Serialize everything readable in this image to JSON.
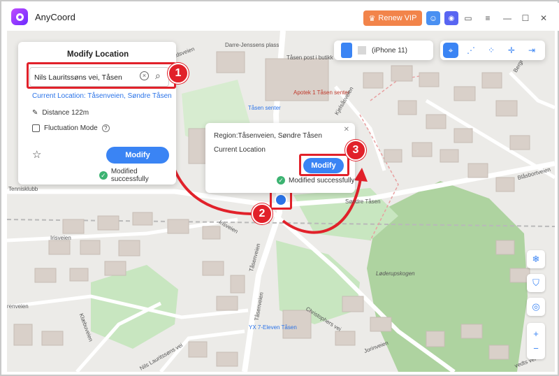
{
  "app": {
    "title": "AnyCoord",
    "renew_label": "Renew VIP"
  },
  "device": {
    "name": "(iPhone 11)"
  },
  "modify_panel": {
    "title": "Modify Location",
    "search_value": "Nils Lauritssøns vei,  Tåsen",
    "current_location": "Current Location: Tåsenveien, Søndre Tåsen",
    "distance": "Distance 122m",
    "fluctuation_label": "Fluctuation Mode",
    "modify_label": "Modify",
    "success": "Modified successfully"
  },
  "popup": {
    "region": "Region:Tåsenveien, Søndre Tåsen",
    "current": "Current Location",
    "modify_label": "Modify",
    "success": "Modified successfully"
  },
  "steps": [
    "1",
    "2",
    "3"
  ],
  "map_labels": [
    "Darre-Jenssens plass",
    "Tåsen post i butikk",
    "Apotek 1 Tåsen senter",
    "Tåsen senter",
    "Tennisklubb",
    "Irisveien",
    "Irisveien",
    "Tåsenveien",
    "Tåsenveien",
    "Søndre Tåsen",
    "Løderupskogen",
    "Christophers vei",
    "YX 7-Eleven Tåsen",
    "Blåsbortveien",
    "Klæbuveien",
    "renveien",
    "Nils Lauritssøns vei",
    "Bergr",
    "Kjelsåsveien",
    "Jorinveien",
    "Løvsetdsveien",
    "vedts vei"
  ],
  "colors": {
    "accent": "#3a84f4",
    "highlight": "#e1212a",
    "renew": "#f2844a"
  }
}
